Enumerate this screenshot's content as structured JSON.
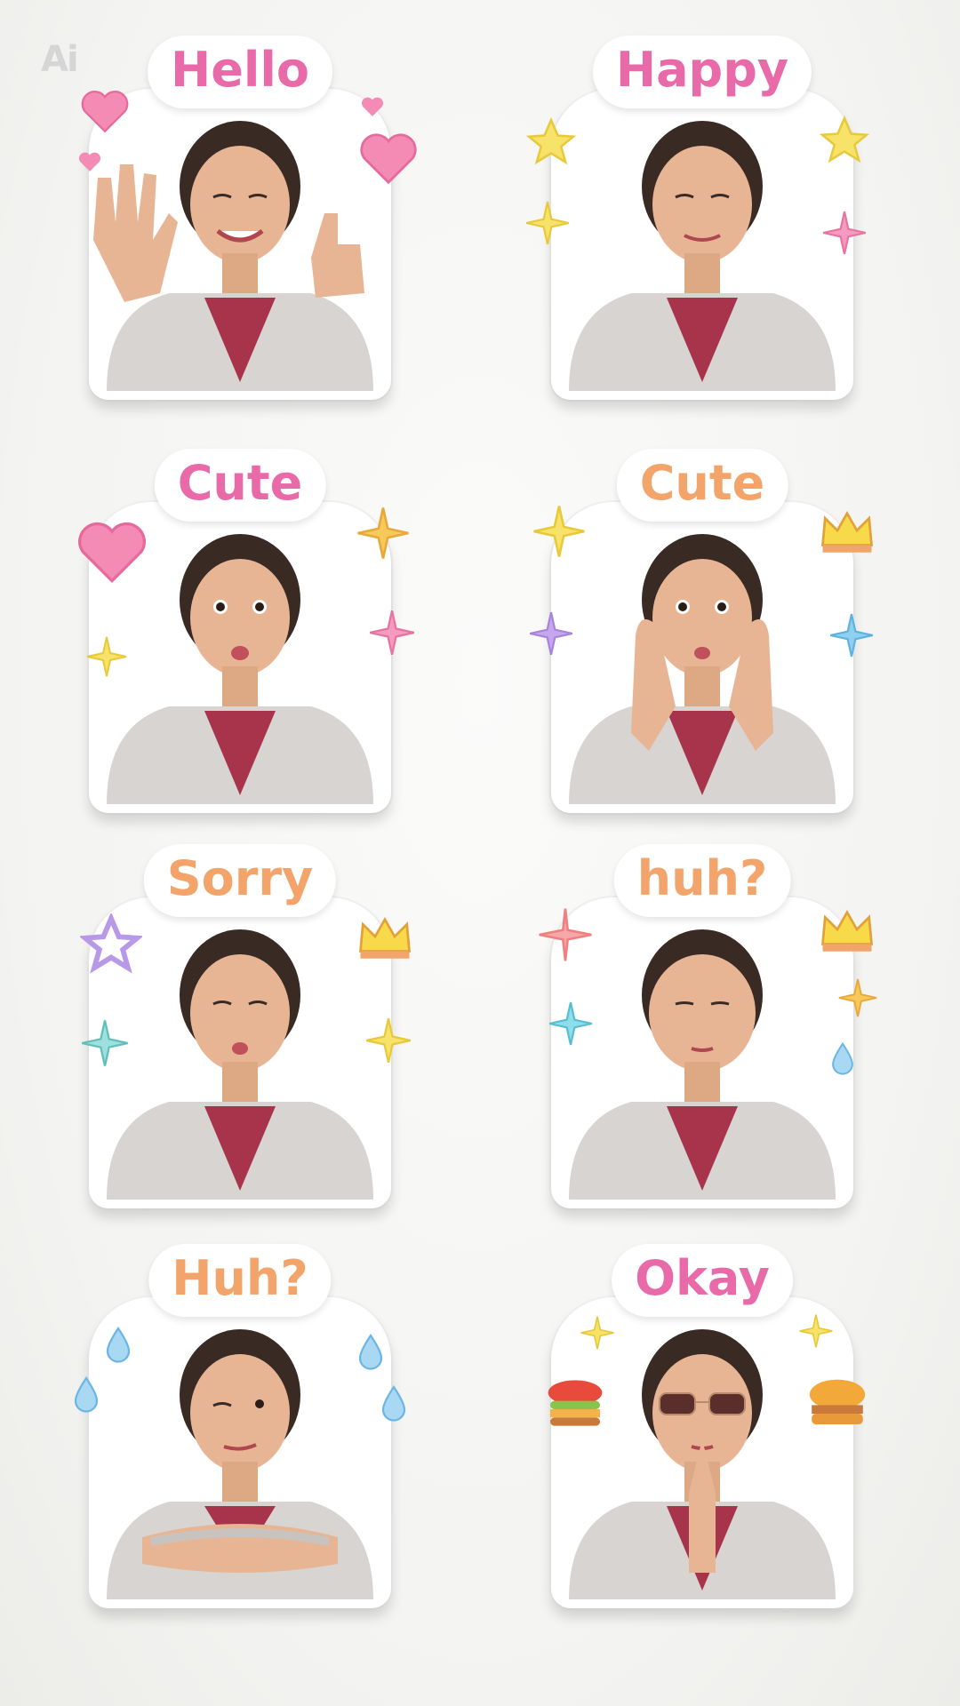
{
  "watermark": "Ai",
  "stickers": [
    {
      "label": "Hello",
      "label_color": "#e86aa8",
      "pose": "wave-thumbs-up",
      "icons": [
        "heart-icon",
        "heart-icon",
        "heart-icon",
        "heart-icon"
      ]
    },
    {
      "label": "Happy",
      "label_color": "#e86aa8",
      "pose": "wink-smile",
      "icons": [
        "star-icon",
        "star-icon",
        "star-icon",
        "sparkle-icon"
      ]
    },
    {
      "label": "Cute",
      "label_color": "#e86aa8",
      "pose": "pout",
      "icons": [
        "heart-icon",
        "sparkle-icon",
        "sparkle-icon",
        "sparkle-icon"
      ]
    },
    {
      "label": "Cute",
      "label_color": "#f2a46a",
      "pose": "hands-on-cheeks",
      "icons": [
        "sparkle-icon",
        "crown-icon",
        "sparkle-icon",
        "sparkle-icon"
      ]
    },
    {
      "label": "Sorry",
      "label_color": "#f2a46a",
      "pose": "kiss-face",
      "icons": [
        "star-outline-icon",
        "crown-icon",
        "sparkle-icon",
        "sparkle-icon"
      ]
    },
    {
      "label": "huh?",
      "label_color": "#f2a46a",
      "pose": "puffed-cheeks",
      "icons": [
        "sparkle-icon",
        "crown-icon",
        "sparkle-icon",
        "sparkle-icon",
        "droplet-icon"
      ]
    },
    {
      "label": "Huh?",
      "label_color": "#f2a46a",
      "pose": "arms-crossed",
      "icons": [
        "droplet-icon",
        "droplet-icon",
        "droplet-icon",
        "droplet-icon"
      ]
    },
    {
      "label": "Okay",
      "label_color": "#e86aa8",
      "pose": "sunglasses-pray",
      "icons": [
        "sparkle-icon",
        "sparkle-icon",
        "burger-icon",
        "burger-icon"
      ]
    }
  ]
}
